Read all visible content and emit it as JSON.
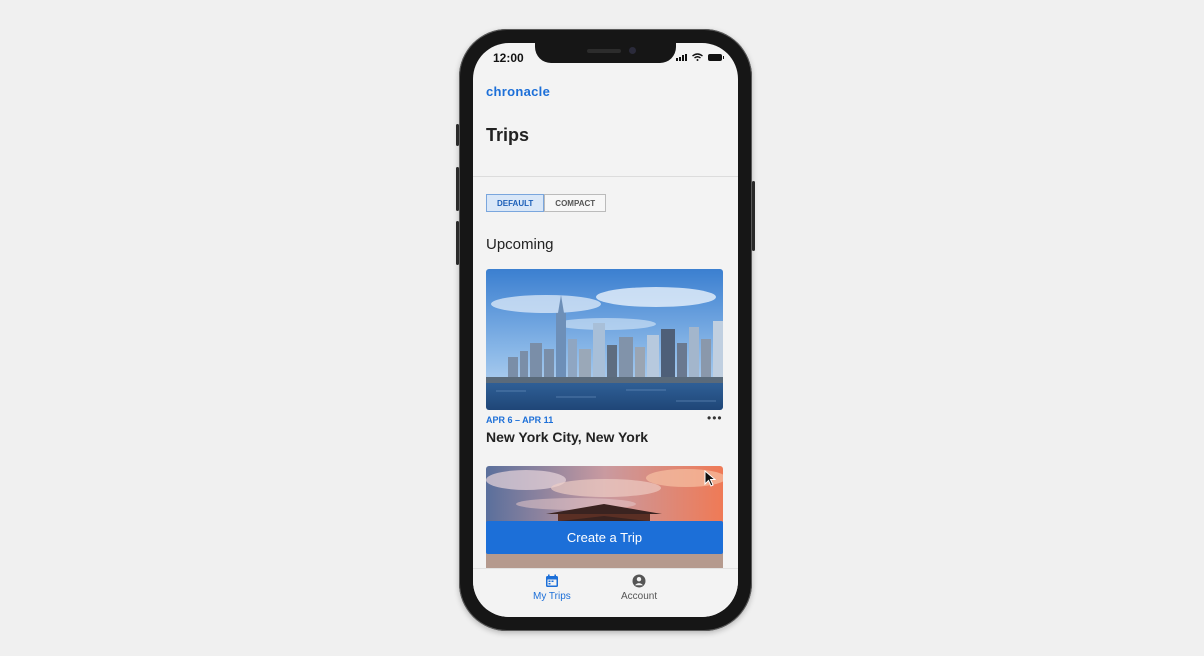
{
  "status_bar": {
    "time": "12:00"
  },
  "app": {
    "brand": "chronacle",
    "page_title": "Trips"
  },
  "view_toggle": {
    "default_label": "DEFAULT",
    "compact_label": "COMPACT",
    "selected": "DEFAULT"
  },
  "section_title": "Upcoming",
  "trips": [
    {
      "dates": "APR 6 – APR 11",
      "title": "New York City, New York",
      "more": "•••"
    }
  ],
  "create_button": "Create a Trip",
  "tabbar": {
    "trips_label": "My Trips",
    "account_label": "Account"
  },
  "colors": {
    "accent": "#1c6fd8",
    "background": "#f0f0f0"
  },
  "icons": [
    "calendar-icon",
    "account-icon",
    "more-icon",
    "cursor-icon",
    "signal-icon",
    "wifi-icon",
    "battery-icon"
  ]
}
